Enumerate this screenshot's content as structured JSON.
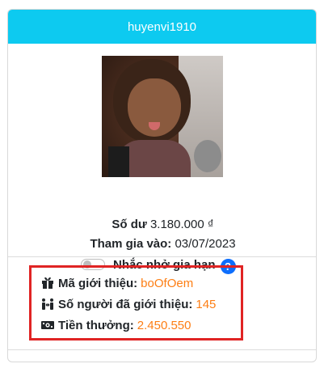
{
  "header": {
    "username": "huyenvi1910"
  },
  "profile": {
    "balance_label": "Số dư",
    "balance_value": "3.180.000 ₫",
    "join_label": "Tham gia vào:",
    "join_value": "03/07/2023",
    "reminder_label": "Nhắc nhở gia hạn",
    "reminder_enabled": false,
    "help_glyph": "?"
  },
  "referral": {
    "code_label": "Mã giới thiệu:",
    "code_value": "boOfOem",
    "count_label": "Số người đã giới thiệu:",
    "count_value": "145",
    "bonus_label": "Tiền thưởng:",
    "bonus_value": "2.450.550",
    "icons": [
      "gift-icon",
      "people-arrows-icon",
      "money-bill-icon"
    ]
  },
  "colors": {
    "header_bg": "#0dcaf0",
    "accent_value": "#fd7e14",
    "highlight_border": "#e02424",
    "help_bg": "#0d6efd"
  }
}
